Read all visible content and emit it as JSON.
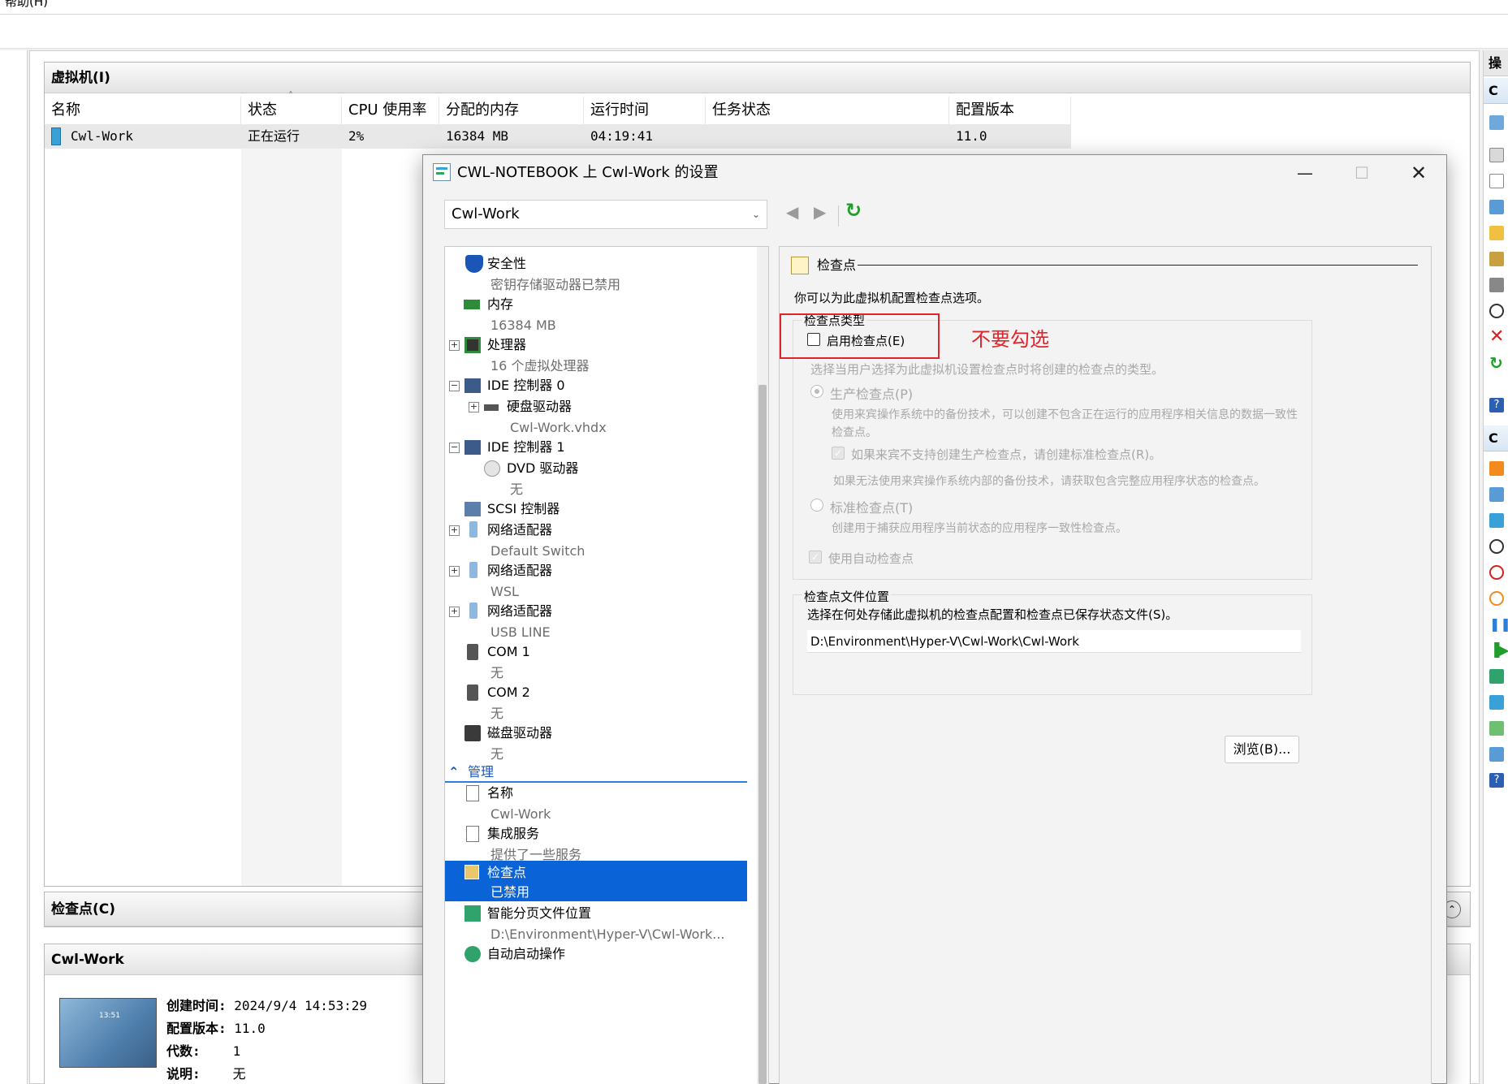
{
  "menu": {
    "help": "帮助(H)"
  },
  "vm_panel": {
    "title": "虚拟机(I)",
    "columns": [
      "名称",
      "状态",
      "CPU 使用率",
      "分配的内存",
      "运行时间",
      "任务状态",
      "配置版本"
    ],
    "rows": [
      {
        "name": "Cwl-Work",
        "state": "正在运行",
        "cpu": "2%",
        "memory": "16384 MB",
        "uptime": "04:19:41",
        "task": "",
        "version": "11.0"
      }
    ]
  },
  "checkpoints_panel": {
    "title": "检查点(C)"
  },
  "details_panel": {
    "title": "Cwl-Work",
    "thumb_time": "13:51",
    "fields": [
      {
        "label": "创建时间:",
        "value": "2024/9/4 14:53:29"
      },
      {
        "label": "配置版本:",
        "value": "11.0"
      },
      {
        "label": "代数:",
        "value": "1"
      },
      {
        "label": "说明:",
        "value": "无"
      }
    ]
  },
  "actions": {
    "header": "操",
    "group1": "C",
    "group2": "C"
  },
  "dialog": {
    "title": "CWL-NOTEBOOK 上 Cwl-Work 的设置",
    "vm_select": "Cwl-Work",
    "tree": {
      "security": {
        "label": "安全性",
        "sub": "密钥存储驱动器已禁用"
      },
      "memory": {
        "label": "内存",
        "sub": "16384 MB"
      },
      "processor": {
        "label": "处理器",
        "sub": "16 个虚拟处理器"
      },
      "ide0": {
        "label": "IDE 控制器 0"
      },
      "hdd": {
        "label": "硬盘驱动器",
        "sub": "Cwl-Work.vhdx"
      },
      "ide1": {
        "label": "IDE 控制器 1"
      },
      "dvd": {
        "label": "DVD 驱动器",
        "sub": "无"
      },
      "scsi": {
        "label": "SCSI 控制器"
      },
      "nic1": {
        "label": "网络适配器",
        "sub": "Default Switch"
      },
      "nic2": {
        "label": "网络适配器",
        "sub": "WSL"
      },
      "nic3": {
        "label": "网络适配器",
        "sub": "USB LINE"
      },
      "com1": {
        "label": "COM 1",
        "sub": "无"
      },
      "com2": {
        "label": "COM 2",
        "sub": "无"
      },
      "floppy": {
        "label": "磁盘驱动器",
        "sub": "无"
      },
      "management": {
        "label": "管理"
      },
      "name": {
        "label": "名称",
        "sub": "Cwl-Work"
      },
      "integration": {
        "label": "集成服务",
        "sub": "提供了一些服务"
      },
      "checkpoints": {
        "label": "检查点",
        "sub": "已禁用"
      },
      "paging": {
        "label": "智能分页文件位置",
        "sub": "D:\\Environment\\Hyper-V\\Cwl-Work..."
      },
      "autostart": {
        "label": "自动启动操作"
      }
    },
    "content": {
      "section_title": "检查点",
      "intro": "你可以为此虚拟机配置检查点选项。",
      "type_group": "检查点类型",
      "enable_checkbox": "启用检查点(E)",
      "annotation": "不要勾选",
      "select_type": "选择当用户选择为此虚拟机设置检查点时将创建的检查点的类型。",
      "production": "生产检查点(P)",
      "production_desc_1": "使用来宾操作系统中的备份技术，可以创建不包含正在运行的应用程序相关信息的数据一致性",
      "production_desc_2": "检查点。",
      "fallback_checkbox": "如果来宾不支持创建生产检查点，请创建标准检查点(R)。",
      "fallback_desc": "如果无法使用来宾操作系统内部的备份技术，请获取包含完整应用程序状态的检查点。",
      "standard": "标准检查点(T)",
      "standard_desc": "创建用于捕获应用程序当前状态的应用程序一致性检查点。",
      "auto_checkbox": "使用自动检查点",
      "location_group": "检查点文件位置",
      "location_desc": "选择在何处存储此虚拟机的检查点配置和检查点已保存状态文件(S)。",
      "location_path": "D:\\Environment\\Hyper-V\\Cwl-Work\\Cwl-Work",
      "browse": "浏览(B)..."
    },
    "colors": {
      "selection": "#0a64d8",
      "annotation": "#e0242b",
      "accent_green": "#1f9e2c"
    }
  }
}
